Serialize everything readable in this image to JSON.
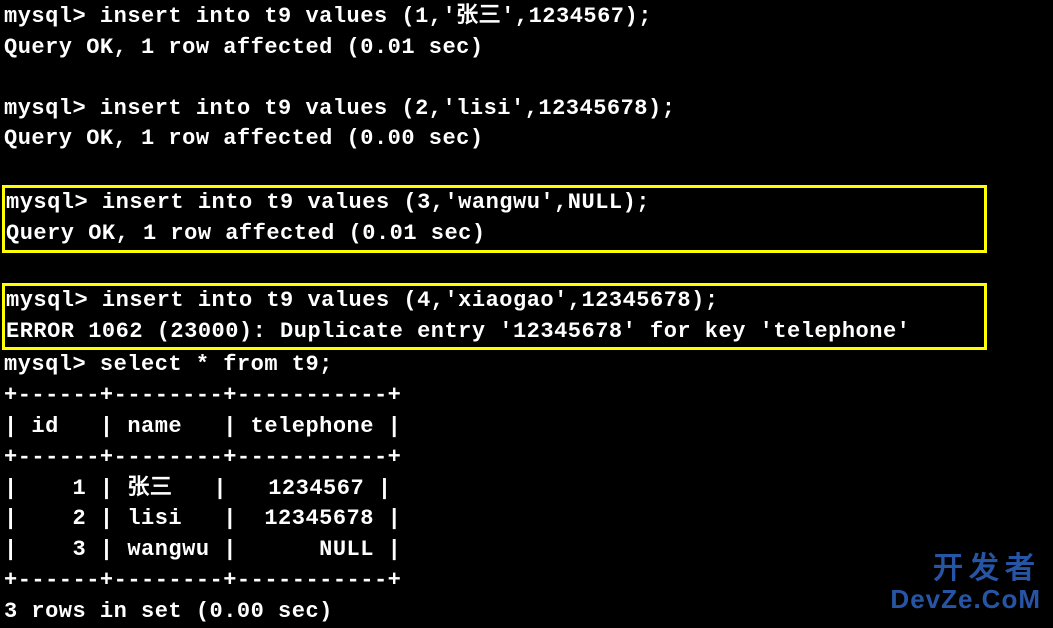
{
  "prompt": "mysql> ",
  "commands": {
    "insert1": "insert into t9 values (1,'张三',1234567);",
    "result1": "Query OK, 1 row affected (0.01 sec)",
    "insert2": "insert into t9 values (2,'lisi',12345678);",
    "result2": "Query OK, 1 row affected (0.00 sec)",
    "insert3": "insert into t9 values (3,'wangwu',NULL);",
    "result3": "Query OK, 1 row affected (0.01 sec)",
    "insert4": "insert into t9 values (4,'xiaogao',12345678);",
    "error4": "ERROR 1062 (23000): Duplicate entry '12345678' for key 'telephone'",
    "select": "select * from t9;"
  },
  "table": {
    "border_top": "+------+--------+-----------+",
    "header": "| id   | name   | telephone |",
    "border_mid": "+------+--------+-----------+",
    "row1": "|    1 | 张三   |   1234567 |",
    "row2": "|    2 | lisi   |  12345678 |",
    "row3": "|    3 | wangwu |      NULL |",
    "border_bottom": "+------+--------+-----------+",
    "footer": "3 rows in set (0.00 sec)"
  },
  "watermark": {
    "cn": "开发者",
    "en": "DevZe.CoM"
  }
}
